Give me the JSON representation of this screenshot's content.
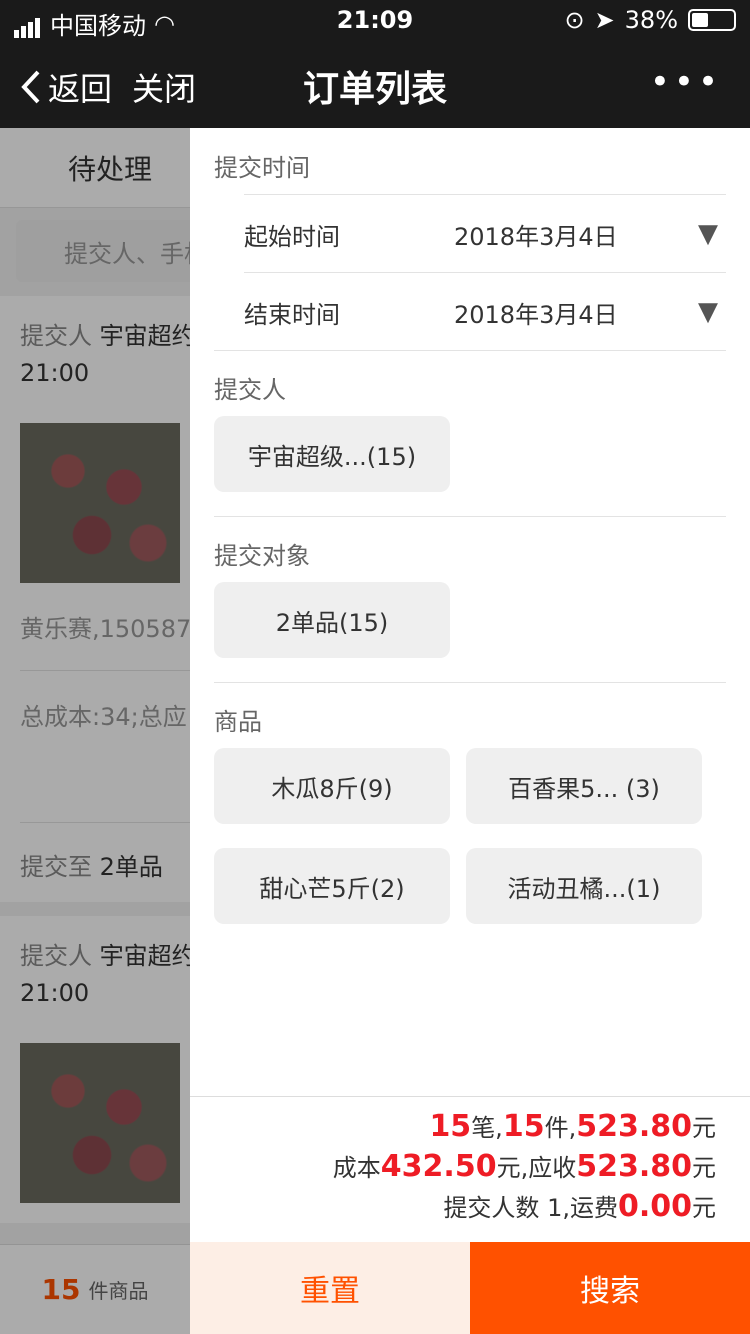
{
  "status": {
    "carrier": "中国移动",
    "time": "21:09",
    "battery": "38%"
  },
  "nav": {
    "back": "返回",
    "close": "关闭",
    "title": "订单列表",
    "more": "•••"
  },
  "bg": {
    "tab": "待处理",
    "search_placeholder": "提交人、手机",
    "cards": [
      {
        "who_label": "提交人",
        "who": "宇宙超约",
        "time": "21:00",
        "contact": "黄乐赛,150587",
        "cost": "总成本:34;总应",
        "target_label": "提交至",
        "target": "2单品"
      },
      {
        "who_label": "提交人",
        "who": "宇宙超约",
        "time": "21:00"
      }
    ],
    "footer": {
      "count": "15",
      "text": "件商品"
    }
  },
  "drawer": {
    "submit_time": {
      "title": "提交时间",
      "start_label": "起始时间",
      "start": "2018年3月4日",
      "end_label": "结束时间",
      "end": "2018年3月4日",
      "arrow": "▼"
    },
    "submitter": {
      "title": "提交人",
      "chips": [
        "宇宙超级...(15)"
      ]
    },
    "target": {
      "title": "提交对象",
      "chips": [
        "2单品(15)"
      ]
    },
    "goods": {
      "title": "商品",
      "chips": [
        "木瓜8斤(9)",
        "百香果5... (3)",
        "甜心芒5斤(2)",
        "活动丑橘...(1)"
      ]
    },
    "summary": {
      "orders": "15",
      "orders_unit": "笔,",
      "items": "15",
      "items_unit": "件,",
      "amount": "523.80",
      "amount_unit": "元",
      "cost_label": "成本",
      "cost": "432.50",
      "cost_unit": "元,应收",
      "receivable": "523.80",
      "receivable_unit": "元",
      "submitters_label": "提交人数 1,运费",
      "freight": "0.00",
      "freight_unit": "元"
    },
    "buttons": {
      "reset": "重置",
      "search": "搜索"
    }
  }
}
